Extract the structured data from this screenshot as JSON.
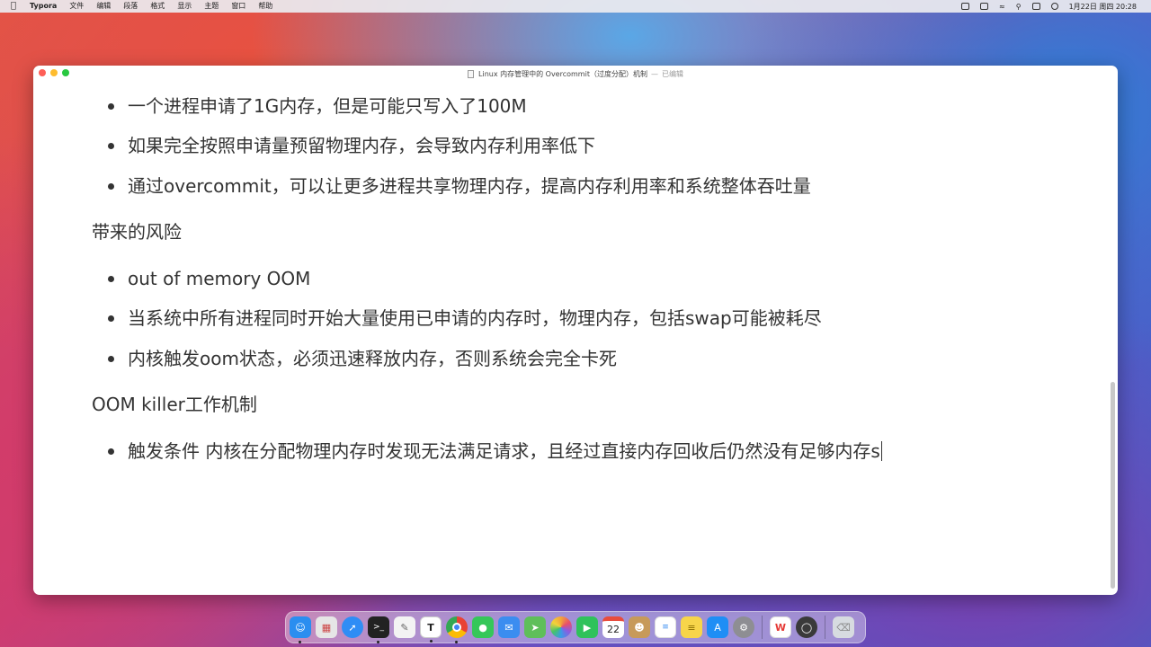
{
  "menubar": {
    "app_name": "Typora",
    "items": [
      "文件",
      "编辑",
      "段落",
      "格式",
      "显示",
      "主题",
      "窗口",
      "帮助"
    ],
    "clock": "1月22日 周四  20:28"
  },
  "window": {
    "title": "Linux 内存管理中的 Overcommit（过度分配）机制",
    "separator": "—",
    "status": "已编辑"
  },
  "document": {
    "bullets_top": [
      "一个进程申请了1G内存，但是可能只写入了100M",
      "如果完全按照申请量预留物理内存，会导致内存利用率低下",
      "通过overcommit，可以让更多进程共享物理内存，提高内存利用率和系统整体吞吐量"
    ],
    "heading_risks": "带来的风险",
    "bullets_risks": [
      "out of memory OOM",
      "当系统中所有进程同时开始大量使用已申请的内存时，物理内存，包括swap可能被耗尽",
      "内核触发oom状态，必须迅速释放内存，否则系统会完全卡死"
    ],
    "heading_killer": "OOM killer工作机制",
    "bullets_killer": [
      "触发条件 内核在分配物理内存时发现无法满足请求，且经过直接内存回收后仍然没有足够内存s"
    ]
  },
  "dock": {
    "icons": [
      {
        "name": "finder-icon",
        "color": "#2a8ef0"
      },
      {
        "name": "launchpad-icon",
        "color": "#e6e6e6"
      },
      {
        "name": "safari-icon",
        "color": "#2f8df5"
      },
      {
        "name": "terminal-icon",
        "color": "#222222"
      },
      {
        "name": "textedit-icon",
        "color": "#f3f3f3"
      },
      {
        "name": "typora-icon",
        "color": "#ffffff"
      },
      {
        "name": "chrome-icon",
        "color": "#e94235"
      },
      {
        "name": "messages-icon",
        "color": "#35c759"
      },
      {
        "name": "mail-icon",
        "color": "#3b8df0"
      },
      {
        "name": "maps-icon",
        "color": "#5fbf5a"
      },
      {
        "name": "photos-icon",
        "color": "#f2a33a"
      },
      {
        "name": "facetime-icon",
        "color": "#2fc25b"
      },
      {
        "name": "calendar-icon",
        "color": "#ffffff"
      },
      {
        "name": "contacts-icon",
        "color": "#c79a5a"
      },
      {
        "name": "reminders-icon",
        "color": "#ffffff"
      },
      {
        "name": "notes-icon",
        "color": "#f7d54a"
      },
      {
        "name": "appstore-icon",
        "color": "#1f8ef5"
      },
      {
        "name": "settings-icon",
        "color": "#8e8e93"
      },
      {
        "name": "wps-icon",
        "color": "#ffffff"
      },
      {
        "name": "quicktime-icon",
        "color": "#3a3a3a"
      },
      {
        "name": "trash-icon",
        "color": "#d7dbe0"
      }
    ],
    "calendar_day": "22",
    "typora_letter": "T"
  }
}
